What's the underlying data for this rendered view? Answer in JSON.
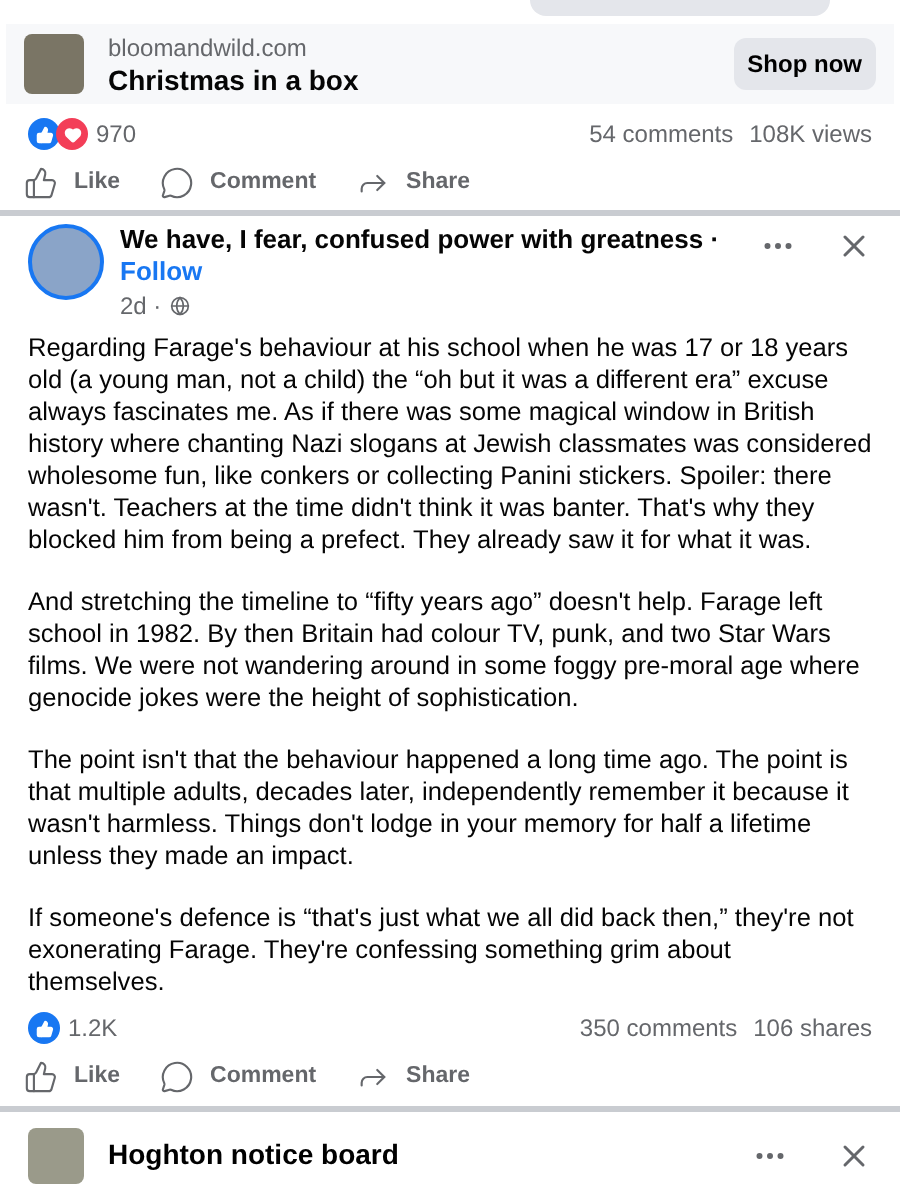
{
  "ad": {
    "domain": "bloomandwild.com",
    "headline": "Christmas in a box",
    "button": "Shop now",
    "reactions_count": "970",
    "comments": "54 comments",
    "views": "108K views"
  },
  "ad_actions": [
    {
      "kind": "like",
      "label": "Like"
    },
    {
      "kind": "comment",
      "label": "Comment"
    },
    {
      "kind": "share",
      "label": "Share"
    }
  ],
  "post_actions": [
    {
      "kind": "like",
      "label": "Like"
    },
    {
      "kind": "comment",
      "label": "Comment"
    },
    {
      "kind": "share",
      "label": "Share"
    }
  ],
  "post": {
    "title": "We have, I fear, confused power with greatness ·",
    "follow": "Follow",
    "time": "2d ·",
    "paragraphs": [
      "Regarding Farage's behaviour at his school when he was 17 or 18 years old (a young man, not a child) the “oh but it was a different era” excuse always fascinates me. As if there was some magical window in British history where chanting Nazi slogans at Jewish classmates was considered wholesome fun, like conkers or collecting Panini stickers. Spoiler: there wasn't. Teachers at the time didn't think it was banter. That's why they blocked him from being a prefect. They already saw it for what it was.",
      "And stretching the timeline to “fifty years ago” doesn't help. Farage left school in 1982. By then Britain had colour TV, punk, and two Star Wars films. We were not wandering around in some foggy pre-moral age where genocide jokes were the height of sophistication.",
      "The point isn't that the behaviour happened a long time ago. The point is that multiple adults, decades later, independently remember it because it wasn't harmless. Things don't lodge in your memory for half a lifetime unless they made an impact.",
      "If someone's defence is “that's just what we all did back then,” they're not exonerating Farage. They're confessing something grim about themselves."
    ],
    "reactions_count": "1.2K",
    "comments": "350 comments",
    "shares": "106 shares"
  },
  "next_post": {
    "title": "Hoghton notice board"
  }
}
